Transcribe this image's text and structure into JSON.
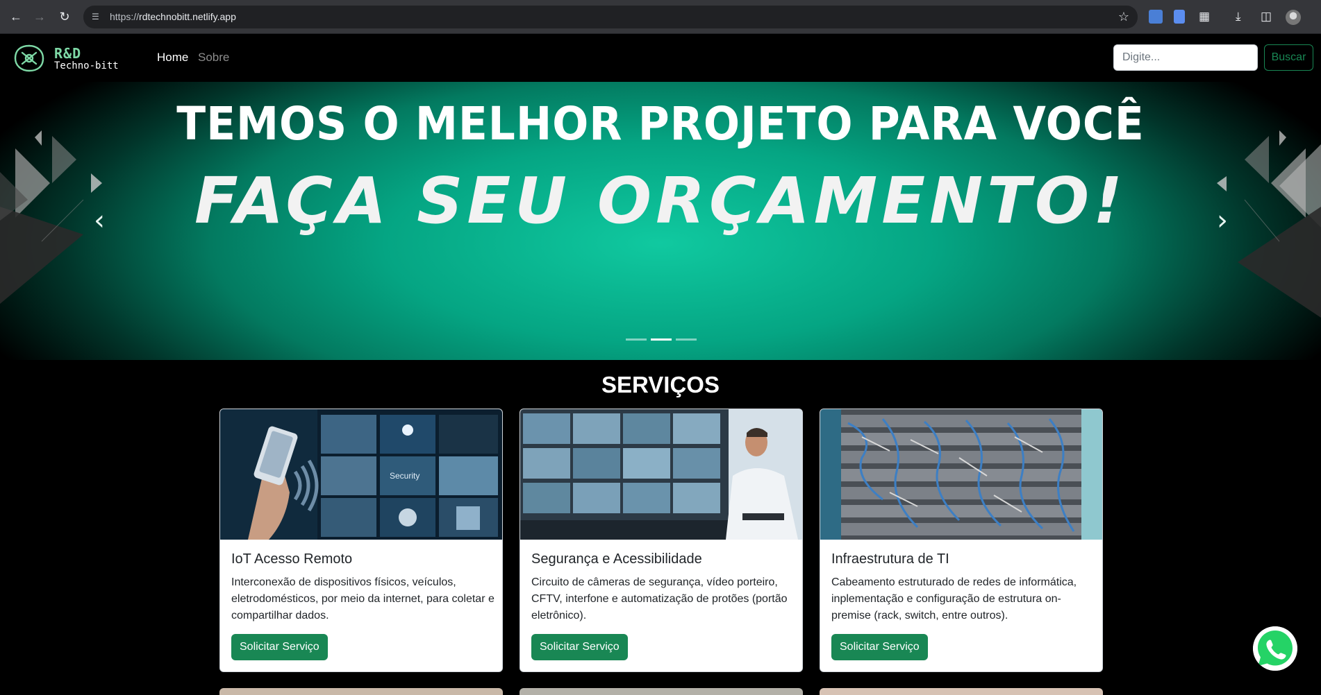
{
  "browser": {
    "url_prefix": "https://",
    "url_host": "rdtechnobitt.netlify.app",
    "back_icon": "arrow-left-icon",
    "forward_icon": "arrow-right-icon",
    "reload_icon": "reload-icon",
    "bookmark_icon": "star-icon"
  },
  "header": {
    "logo_line1": "R&D",
    "logo_line2": "Techno-bitt",
    "nav": {
      "home": "Home",
      "sobre": "Sobre"
    },
    "search_placeholder": "Digite...",
    "search_button": "Buscar"
  },
  "carousel": {
    "line1": "TEMOS O MELHOR PROJETO PARA VOCÊ",
    "line2": "FAÇA SEU ORÇAMENTO!",
    "prev_icon": "chevron-left-icon",
    "next_icon": "chevron-right-icon",
    "indicator_count": 3,
    "active_indicator": 2
  },
  "services": {
    "title": "SERVIÇOS",
    "cards": [
      {
        "title": "IoT Acesso Remoto",
        "text": "Interconexão de dispositivos físicos, veículos, eletrodomésticos, por meio da internet, para coletar e compartilhar dados.",
        "button": "Solicitar Serviço"
      },
      {
        "title": "Segurança e Acessibilidade",
        "text": "Circuito de câmeras de segurança, vídeo porteiro, CFTV, interfone e automatização de protões (portão eletrônico).",
        "button": "Solicitar Serviço"
      },
      {
        "title": "Infraestrutura de TI",
        "text": "Cabeamento estruturado de redes de informática, inplementação e configuração de estrutura on-premise (rack, switch, entre outros).",
        "button": "Solicitar Serviço"
      }
    ]
  },
  "colors": {
    "brand_green": "#198754",
    "hero_teal": "#05a583",
    "whatsapp_green": "#25d366"
  }
}
